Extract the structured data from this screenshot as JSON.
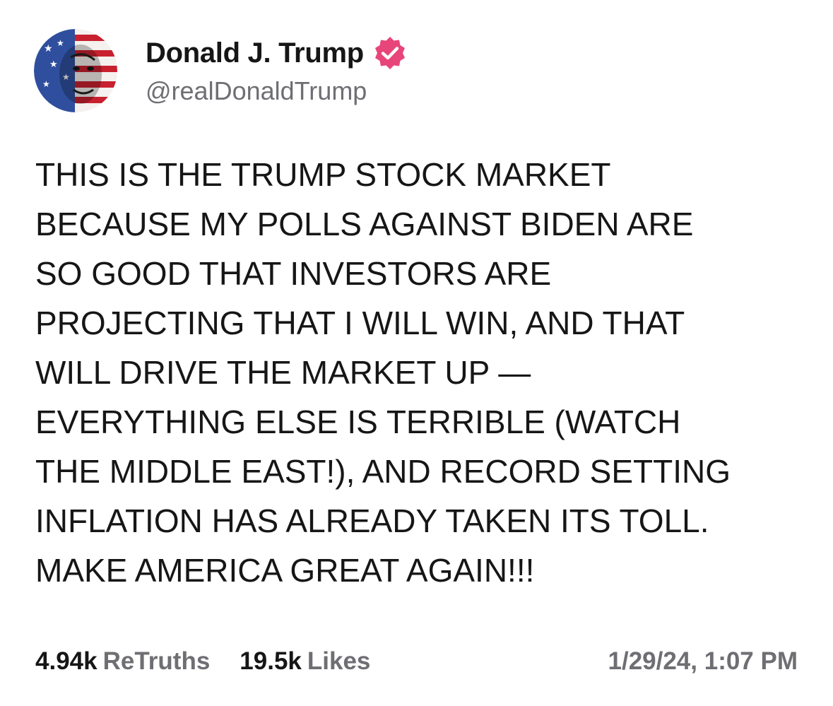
{
  "author": {
    "display_name": "Donald J. Trump",
    "handle": "@realDonaldTrump",
    "verified_icon": "verified-badge-icon",
    "verified_color": "#e8457a",
    "avatar_icon": "profile-avatar"
  },
  "post": {
    "text": "THIS IS THE TRUMP STOCK MARKET\nBECAUSE MY POLLS AGAINST BIDEN ARE\nSO GOOD THAT INVESTORS ARE\nPROJECTING THAT I WILL WIN, AND THAT\nWILL DRIVE THE MARKET UP —\nEVERYTHING ELSE IS TERRIBLE (WATCH\nTHE MIDDLE EAST!), AND RECORD SETTING\nINFLATION HAS ALREADY TAKEN ITS TOLL.\nMAKE AMERICA GREAT AGAIN!!!"
  },
  "stats": {
    "retruths_count": "4.94k",
    "retruths_label": "ReTruths",
    "likes_count": "19.5k",
    "likes_label": "Likes"
  },
  "timestamp": "1/29/24, 1:07 PM"
}
